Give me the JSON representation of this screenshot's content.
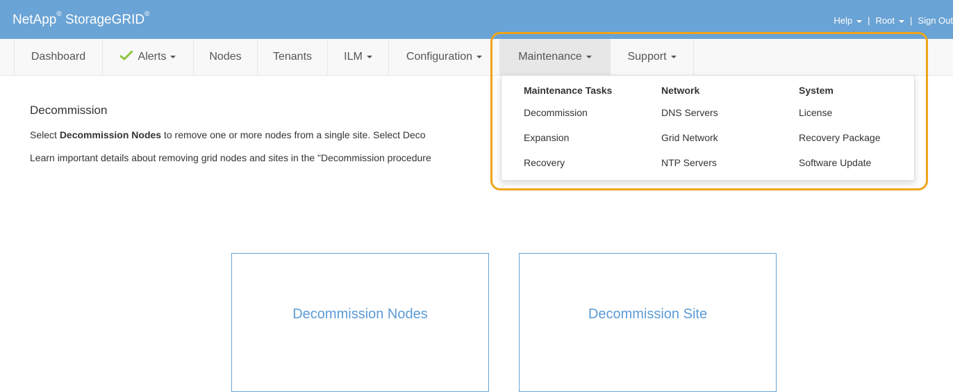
{
  "brand": {
    "name": "NetApp",
    "product": "StorageGRID",
    "reg": "®"
  },
  "user_links": {
    "help": "Help",
    "user": "Root",
    "sep": "|",
    "signout": "Sign Out"
  },
  "nav": {
    "items": [
      {
        "label": "Dashboard"
      },
      {
        "label": "Alerts"
      },
      {
        "label": "Nodes"
      },
      {
        "label": "Tenants"
      },
      {
        "label": "ILM"
      },
      {
        "label": "Configuration"
      },
      {
        "label": "Maintenance"
      },
      {
        "label": "Support"
      }
    ],
    "active": "Maintenance"
  },
  "page": {
    "title": "Decommission",
    "p1_pre": "Select ",
    "p1_bold": "Decommission Nodes",
    "p1_post": " to remove one or more nodes from a single site. Select Deco",
    "p2": "Learn important details about removing grid nodes and sites in the \"Decommission procedure"
  },
  "dropdown": {
    "columns": [
      {
        "heading": "Maintenance Tasks",
        "links": [
          "Decommission",
          "Expansion",
          "Recovery"
        ]
      },
      {
        "heading": "Network",
        "links": [
          "DNS Servers",
          "Grid Network",
          "NTP Servers"
        ]
      },
      {
        "heading": "System",
        "links": [
          "License",
          "Recovery Package",
          "Software Update"
        ]
      }
    ]
  },
  "cards": {
    "nodes": "Decommission Nodes",
    "site": "Decommission Site"
  },
  "colors": {
    "topbar": "#6aa3d5",
    "highlight": "#f0a419",
    "link_blue": "#5b9bd5",
    "check_green": "#8cc63f"
  },
  "icons": {
    "alerts": "check-icon",
    "dropdown": "caret-down-icon"
  }
}
